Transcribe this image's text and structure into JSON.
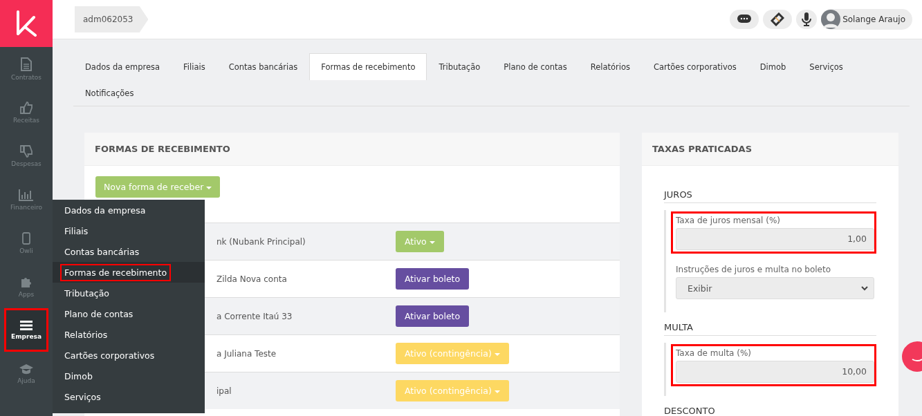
{
  "breadcrumb": "adm062053",
  "topbar": {
    "icons": [
      {
        "kind": "chat"
      },
      {
        "kind": "ticket"
      },
      {
        "kind": "mic"
      }
    ],
    "user": "Solange Araujo"
  },
  "sidebar": {
    "items": [
      {
        "label": "Contratos",
        "selected": false,
        "highlighted": false
      },
      {
        "label": "Receitas",
        "selected": false,
        "highlighted": false
      },
      {
        "label": "Despesas",
        "selected": false,
        "highlighted": false
      },
      {
        "label": "Financeiro",
        "selected": false,
        "highlighted": false
      },
      {
        "label": "Owli",
        "selected": false,
        "highlighted": false
      },
      {
        "label": "Apps",
        "selected": false,
        "highlighted": false
      },
      {
        "label": "Empresa",
        "selected": true,
        "highlighted": true
      },
      {
        "label": "Ajuda",
        "selected": false,
        "highlighted": false
      }
    ]
  },
  "tabs": [
    {
      "label": "Dados da empresa",
      "selected": false
    },
    {
      "label": "Filiais",
      "selected": false
    },
    {
      "label": "Contas bancárias",
      "selected": false
    },
    {
      "label": "Formas de recebimento",
      "selected": true
    },
    {
      "label": "Tributação",
      "selected": false
    },
    {
      "label": "Plano de contas",
      "selected": false
    },
    {
      "label": "Relatórios",
      "selected": false
    },
    {
      "label": "Cartões corporativos",
      "selected": false
    },
    {
      "label": "Dimob",
      "selected": false
    },
    {
      "label": "Serviços",
      "selected": false
    },
    {
      "label": "Notificações",
      "selected": false
    }
  ],
  "methods_panel": {
    "title": "FORMAS DE RECEBIMENTO",
    "new_button": "Nova forma de receber",
    "rows": [
      {
        "name": "nk (Nubank Principal)",
        "status": "Ativo",
        "kind": "active"
      },
      {
        "name": "Zilda Nova conta",
        "status": "Ativar boleto",
        "kind": "activate"
      },
      {
        "name": "a Corrente Itaú 33",
        "status": "Ativar boleto",
        "kind": "activate"
      },
      {
        "name": "a Juliana Teste",
        "status": "Ativo (contingência)",
        "kind": "contingency"
      },
      {
        "name": "ipal",
        "status": "Ativo (contingência)",
        "kind": "contingency"
      }
    ]
  },
  "company_menu": {
    "items": [
      {
        "label": "Dados da empresa",
        "selected": false,
        "highlighted": false
      },
      {
        "label": "Filiais",
        "selected": false,
        "highlighted": false
      },
      {
        "label": "Contas bancárias",
        "selected": false,
        "highlighted": false
      },
      {
        "label": "Formas de recebimento",
        "selected": true,
        "highlighted": true
      },
      {
        "label": "Tributação",
        "selected": false,
        "highlighted": false
      },
      {
        "label": "Plano de contas",
        "selected": false,
        "highlighted": false
      },
      {
        "label": "Relatórios",
        "selected": false,
        "highlighted": false
      },
      {
        "label": "Cartões corporativos",
        "selected": false,
        "highlighted": false
      },
      {
        "label": "Dimob",
        "selected": false,
        "highlighted": false
      },
      {
        "label": "Serviços",
        "selected": false,
        "highlighted": false
      }
    ]
  },
  "rates_panel": {
    "title": "TAXAS PRATICADAS",
    "sections": [
      {
        "title": "JUROS",
        "fields": [
          {
            "kind": "input",
            "label": "Taxa de juros mensal (%)",
            "value": "1,00",
            "highlighted": true
          },
          {
            "kind": "select",
            "label": "Instruções de juros e multa no boleto",
            "value": "Exibir",
            "highlighted": false
          }
        ]
      },
      {
        "title": "MULTA",
        "fields": [
          {
            "kind": "input",
            "label": "Taxa de multa (%)",
            "value": "10,00",
            "highlighted": true
          }
        ]
      },
      {
        "title": "DESCONTO"
      }
    ]
  }
}
